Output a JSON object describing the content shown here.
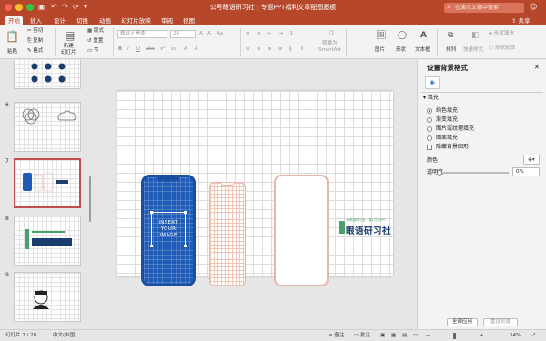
{
  "window": {
    "title": "公号眼语研习社 | 专题PPT福利文章配图画板",
    "dot_colors": [
      "#fc5f57",
      "#fdbc2e",
      "#33c748"
    ]
  },
  "quick_access": {
    "icons": [
      "save-icon",
      "undo-icon",
      "redo-icon",
      "refresh-icon",
      "more-icon"
    ],
    "glyphs": [
      "▣",
      "↶",
      "↷",
      "⟳",
      "▾"
    ]
  },
  "search": {
    "placeholder": "在演示文稿中搜索",
    "glyph": "⌕"
  },
  "user": {
    "glyph": "☺"
  },
  "tabs": [
    "开始",
    "插入",
    "设计",
    "切换",
    "动画",
    "幻灯片放映",
    "审阅",
    "视图"
  ],
  "share": {
    "label": "共享",
    "glyph": "⇧"
  },
  "ribbon": {
    "paste": {
      "label": "粘贴",
      "glyph": "📋"
    },
    "clipboard": [
      {
        "label": "剪切",
        "glyph": "✂"
      },
      {
        "label": "复制",
        "glyph": "⎘"
      },
      {
        "label": "格式",
        "glyph": "✎"
      }
    ],
    "new_slide": {
      "label": "新建\n幻灯片",
      "glyph": "▤"
    },
    "slide_ops": [
      {
        "label": "版式",
        "glyph": "▦"
      },
      {
        "label": "重置",
        "glyph": "↺"
      },
      {
        "label": "节",
        "glyph": "▭"
      }
    ],
    "font_name": "微软正黑体",
    "font_size": "24",
    "font_buttons": [
      "A",
      "A",
      "Aa",
      "B",
      "I",
      "U",
      "abc",
      "x²",
      "x₂",
      "A",
      "A"
    ],
    "para_buttons": [
      "≡",
      "≡",
      "⇤",
      "⇥",
      "↕",
      "≡",
      "≡",
      "≡",
      "≡",
      "‖",
      "⇕"
    ],
    "smartart": {
      "label": "转换为\nSmartArt",
      "glyph": "⧉"
    },
    "picture": {
      "label": "图片",
      "glyph": "🖼"
    },
    "shape": {
      "label": "形状",
      "glyph": "◯"
    },
    "textbox": {
      "label": "文本框",
      "glyph": "A"
    },
    "arrange": {
      "label": "排列",
      "glyph": "⧉"
    },
    "quick_style": {
      "label": "快速样式",
      "glyph": "◧"
    },
    "shape_fill": {
      "label": "形状填充",
      "glyph": "◈"
    },
    "shape_outline": {
      "label": "形状轮廓",
      "glyph": "▢"
    }
  },
  "slides": [
    {
      "num": "6"
    },
    {
      "num": "7"
    },
    {
      "num": "8"
    },
    {
      "num": "9"
    }
  ],
  "slide": {
    "insert_text": [
      "INSERT",
      "YOUR",
      "IMAGE"
    ],
    "logo_tagline": "★ 眼语研习社 · 做1万张PPT",
    "logo_name": "眼语研习社"
  },
  "format_panel": {
    "title": "设置背景格式",
    "close": "✕",
    "fill_icon_glyph": "◈",
    "section": "▾ 填充",
    "options": [
      {
        "label": "纯色填充",
        "selected": true
      },
      {
        "label": "渐变填充",
        "selected": false
      },
      {
        "label": "图片或纹理填充",
        "selected": false
      },
      {
        "label": "图案填充",
        "selected": false
      }
    ],
    "hide_bg": "隐藏背景图形",
    "color_label": "颜色",
    "transparency_label": "透明度",
    "transparency_value": "0%",
    "transparency": 0,
    "apply_all": "全部应用",
    "reset_bg": "重设背景"
  },
  "status": {
    "slide_info": "幻灯片 7 / 20",
    "language": "中文(中国)",
    "notes": "备注",
    "comments": "批注",
    "zoom": "34%"
  }
}
